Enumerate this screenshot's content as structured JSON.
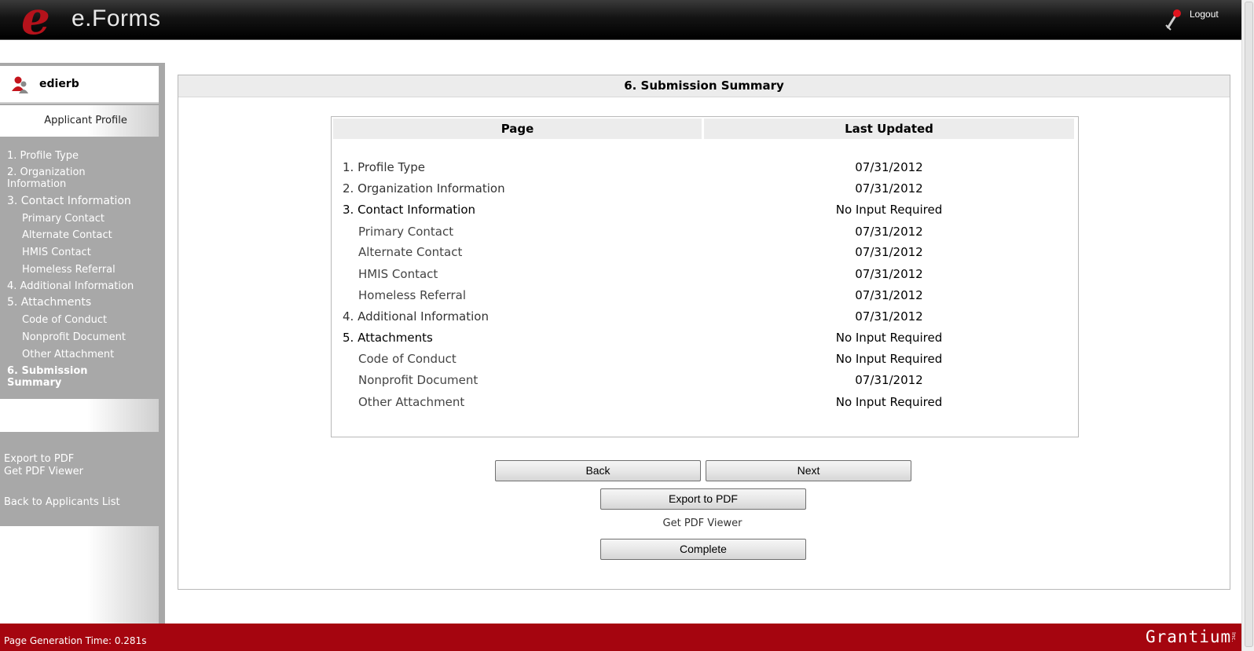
{
  "header": {
    "logo_letter": "e",
    "app_title": "e.Forms",
    "logout_label": "Logout"
  },
  "sidebar": {
    "user_name": "edierb",
    "profile_label": "Applicant Profile",
    "nav": [
      {
        "label": "1. Profile Type"
      },
      {
        "label": "2. Organization Information"
      },
      {
        "label": "3. Contact Information"
      },
      {
        "label": "Primary Contact"
      },
      {
        "label": "Alternate Contact"
      },
      {
        "label": "HMIS Contact"
      },
      {
        "label": "Homeless Referral"
      },
      {
        "label": "4. Additional Information"
      },
      {
        "label": "5. Attachments"
      },
      {
        "label": "Code of Conduct"
      },
      {
        "label": "Nonprofit Document"
      },
      {
        "label": "Other Attachment"
      },
      {
        "label": "6. Submission Summary"
      }
    ],
    "export_pdf": "Export to PDF",
    "get_pdf_viewer": "Get PDF Viewer",
    "back_to_list": "Back to Applicants List"
  },
  "main": {
    "title": "6. Submission Summary",
    "table": {
      "headers": [
        "Page",
        "Last Updated"
      ],
      "rows": [
        {
          "page": "1. Profile Type",
          "updated": "07/31/2012"
        },
        {
          "page": "2. Organization Information",
          "updated": "07/31/2012"
        },
        {
          "page": "3. Contact Information",
          "updated": "No Input Required"
        },
        {
          "page": "Primary Contact",
          "updated": "07/31/2012"
        },
        {
          "page": "Alternate Contact",
          "updated": "07/31/2012"
        },
        {
          "page": "HMIS Contact",
          "updated": "07/31/2012"
        },
        {
          "page": "Homeless Referral",
          "updated": "07/31/2012"
        },
        {
          "page": "4. Additional Information",
          "updated": "07/31/2012"
        },
        {
          "page": "5. Attachments",
          "updated": "No Input Required"
        },
        {
          "page": "Code of Conduct",
          "updated": "No Input Required"
        },
        {
          "page": "Nonprofit Document",
          "updated": "07/31/2012"
        },
        {
          "page": "Other Attachment",
          "updated": "No Input Required"
        }
      ]
    },
    "buttons": {
      "back": "Back",
      "next": "Next",
      "export": "Export to PDF",
      "complete": "Complete"
    },
    "get_pdf_viewer": "Get PDF Viewer"
  },
  "footer": {
    "generation_time": "Page Generation Time: 0.281s",
    "brand": "Grantium",
    "brand_suffix": "Inc."
  },
  "colors": {
    "brand_red": "#a5050f",
    "sidebar_gray": "#a8a8a8",
    "header_black": "#000000"
  },
  "icons": {
    "user": "user-icon",
    "logout": "logout-icon"
  }
}
